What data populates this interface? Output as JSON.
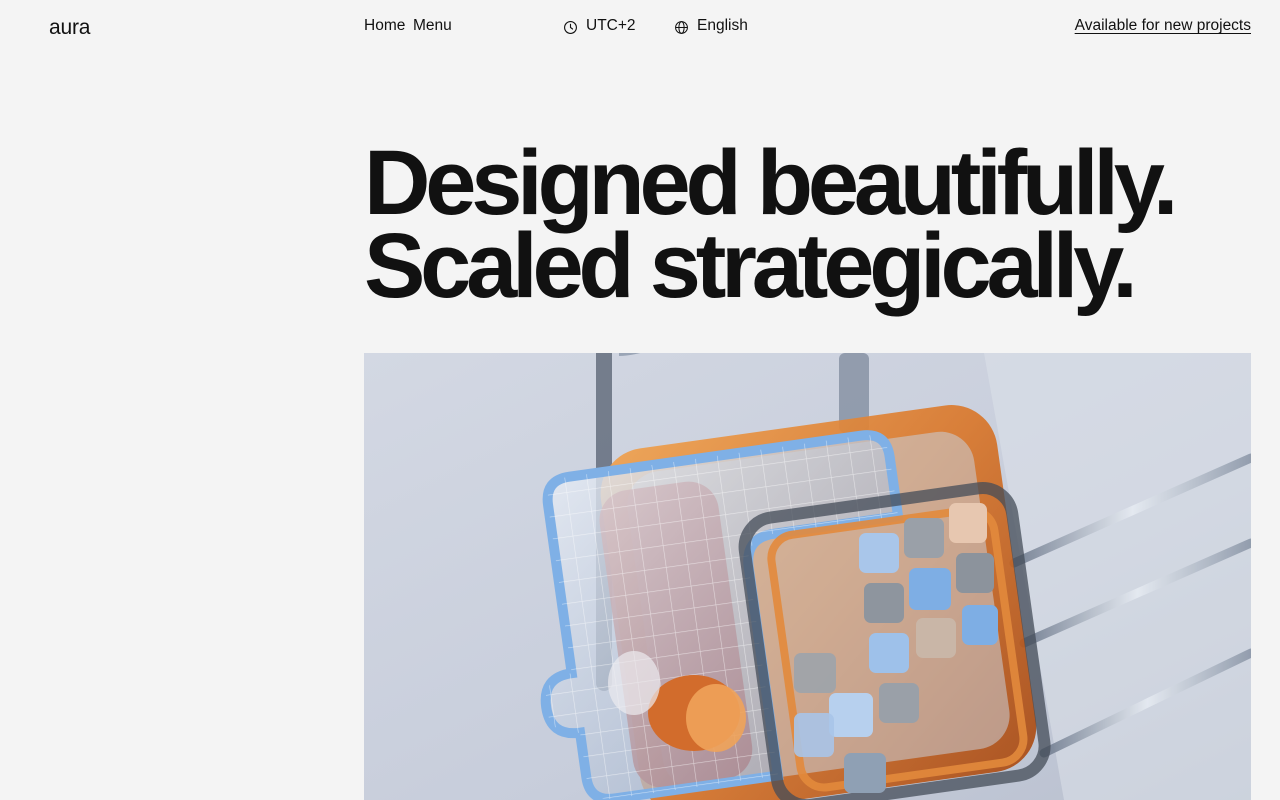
{
  "header": {
    "logo": "aura",
    "nav": {
      "home": "Home",
      "menu": "Menu"
    },
    "timezone": {
      "icon": "clock-icon",
      "label": "UTC+2"
    },
    "language": {
      "icon": "globe-icon",
      "label": "English"
    },
    "cta": "Available for new projects"
  },
  "hero": {
    "headline_line1": "Designed beautifully.",
    "headline_line2": "Scaled strategically.",
    "image": {
      "subject": "glass-puzzle-render"
    }
  },
  "colors": {
    "background": "#f4f4f4",
    "text": "#111111",
    "accent_orange": "#d9772b",
    "accent_blue": "#9fc2e8"
  }
}
